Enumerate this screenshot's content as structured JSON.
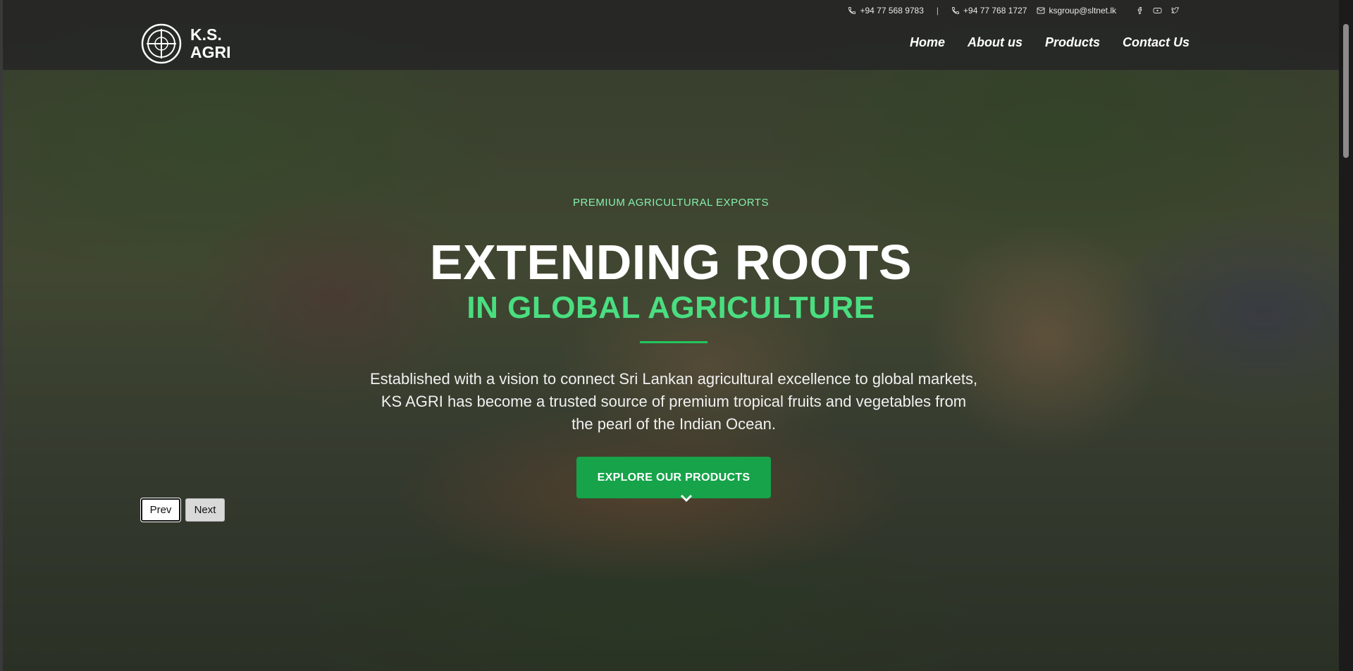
{
  "topbar": {
    "phone1": "+94 77 568 9783",
    "separator": "|",
    "phone2": "+94 77 768 1727",
    "email": "ksgroup@sltnet.lk",
    "social": [
      "facebook-icon",
      "youtube-icon",
      "twitter-icon"
    ]
  },
  "logo": {
    "line1": "K.S.",
    "line2": "AGRI"
  },
  "nav": {
    "items": [
      "Home",
      "About us",
      "Products",
      "Contact Us"
    ]
  },
  "hero": {
    "eyebrow": "PREMIUM AGRICULTURAL EXPORTS",
    "title_line1": "EXTENDING ROOTS",
    "title_line2": "IN GLOBAL AGRICULTURE",
    "description": "Established with a vision to connect Sri Lankan agricultural excellence to global markets, KS AGRI has become a trusted source of premium tropical fruits and vegetables from the pearl of the Indian Ocean.",
    "cta_label": "EXPLORE OUR PRODUCTS"
  },
  "slider": {
    "prev_label": "Prev",
    "next_label": "Next"
  },
  "colors": {
    "accent": "#16a34a",
    "title_green": "#4ade80",
    "eyebrow_green": "#86efac"
  }
}
